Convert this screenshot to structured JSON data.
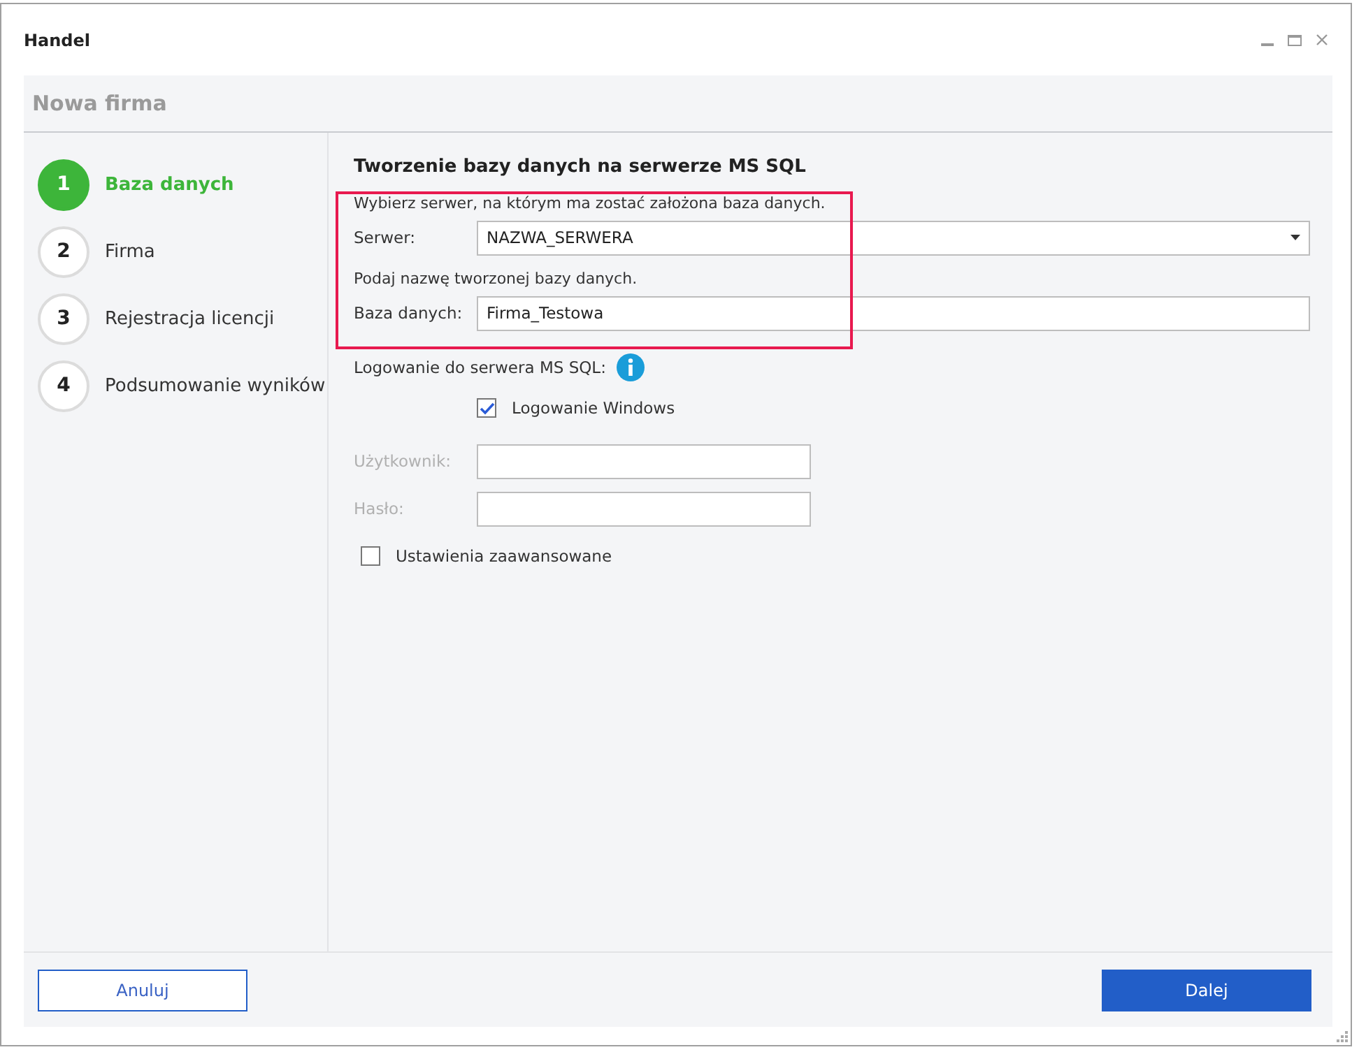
{
  "window": {
    "title": "Handel"
  },
  "wizard": {
    "title": "Nowa firma",
    "steps": [
      {
        "number": "1",
        "label": "Baza danych",
        "selected": true
      },
      {
        "number": "2",
        "label": "Firma",
        "selected": false
      },
      {
        "number": "3",
        "label": "Rejestracja licencji",
        "selected": false
      },
      {
        "number": "4",
        "label": "Podsumowanie wyników",
        "selected": false
      }
    ]
  },
  "content": {
    "title": "Tworzenie bazy danych na serwerze MS SQL",
    "server_hint": "Wybierz serwer, na którym ma zostać założona baza danych.",
    "server": {
      "label": "Serwer:",
      "value": "NAZWA_SERWERA"
    },
    "database_hint": "Podaj nazwę tworzonej bazy danych.",
    "database": {
      "label": "Baza danych:",
      "value": "Firma_Testowa"
    },
    "login_label": "Logowanie do serwera MS SQL:",
    "windows_login": {
      "label": "Logowanie Windows",
      "checked": true
    },
    "user": {
      "label": "Użytkownik:",
      "disabled": true
    },
    "password": {
      "label": "Hasło:",
      "disabled": true
    },
    "advanced": {
      "label": "Ustawienia zaawansowane",
      "checked": false
    }
  },
  "buttons": {
    "cancel": "Anuluj",
    "next": "Dalej"
  }
}
